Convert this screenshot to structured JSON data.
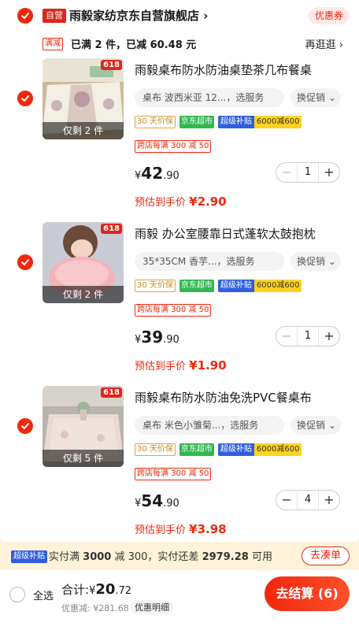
{
  "colors": {
    "accent": "#f2270c",
    "subsidy_blue": "#2f5ee0",
    "jd_green": "#2fb84f",
    "subsidy_yellow": "#ffd21e"
  },
  "shop": {
    "self_tag": "自营",
    "name": "雨毅家纺京东自营旗舰店",
    "coupon_label": "优惠券"
  },
  "promo": {
    "tag": "满减",
    "text": "已满 2 件，已减 60.48 元",
    "link": "再逛逛"
  },
  "items": [
    {
      "badge": "618",
      "stock": "仅剩 2 件",
      "title": "雨毅桌布防水防油桌垫茶几布餐桌",
      "sku": "桌布 波西米亚 12...，选服务",
      "promo_select": "换促销",
      "tags": {
        "guarantee": "30 天价保",
        "jd_market": "京东超市",
        "subsidy_a": "超级补贴",
        "subsidy_b": "6000减600"
      },
      "cross_promo": "跨店每满 300 减 50",
      "price": {
        "currency": "¥",
        "int": "42",
        "dec": ".90"
      },
      "qty": "1",
      "est_label": "预估到手价",
      "est_price": "¥2.90"
    },
    {
      "badge": "618",
      "stock": "仅剩 2 件",
      "title": "雨毅 办公室腰靠日式蓬软太鼓抱枕",
      "sku": "35*35CM 香芋...，选服务",
      "promo_select": "换促销",
      "tags": {
        "guarantee": "30 天价保",
        "jd_market": "京东超市",
        "subsidy_a": "超级补贴",
        "subsidy_b": "6000减600"
      },
      "cross_promo": "跨店每满 300 减 50",
      "price": {
        "currency": "¥",
        "int": "39",
        "dec": ".90"
      },
      "qty": "1",
      "est_label": "预估到手价",
      "est_price": "¥1.90"
    },
    {
      "badge": "618",
      "stock": "仅剩 5 件",
      "title": "雨毅桌布防水防油免洗PVC餐桌布",
      "sku": "桌布 米色小雏菊...，选服务",
      "promo_select": "换促销",
      "tags": {
        "guarantee": "30 天价保",
        "jd_market": "京东超市",
        "subsidy_a": "超级补贴",
        "subsidy_b": "6000减600"
      },
      "cross_promo": "跨店每满 300 减 50",
      "price": {
        "currency": "¥",
        "int": "54",
        "dec": ".90"
      },
      "qty": "4",
      "est_label": "预估到手价",
      "est_price": "¥3.98"
    }
  ],
  "subsidy_bar": {
    "tag": "超级补贴",
    "text_prefix": "实付满",
    "threshold": "3000",
    "text_mid": "减 300，实付还差",
    "remaining": "2979.28",
    "text_suffix": "可用",
    "button": "去凑单"
  },
  "footer": {
    "select_all": "全选",
    "total_label": "合计:",
    "total_currency": "¥",
    "total_int": "20",
    "total_dec": ".72",
    "discount": "优惠减: ¥281.68",
    "detail": "优惠明细",
    "checkout": "去结算 (6)"
  }
}
